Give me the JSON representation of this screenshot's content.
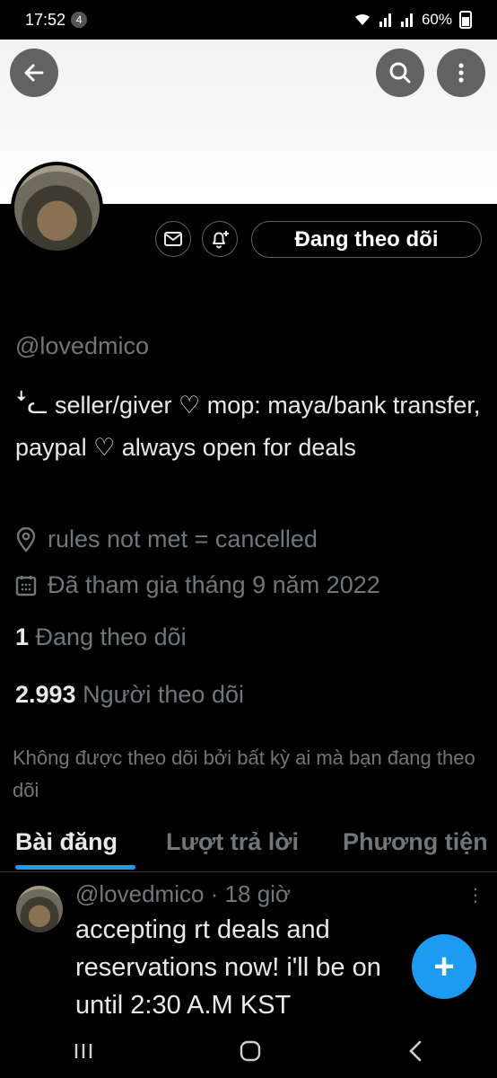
{
  "status": {
    "time": "17:52",
    "notif_count": "4",
    "battery": "60%"
  },
  "profile": {
    "handle": "@lovedmico",
    "bio": "ꜜᓚ seller/giver ♡ mop: maya/bank transfer, paypal ♡ always open for deals",
    "location": "rules not met = cancelled",
    "joined": "Đã tham gia tháng 9 năm 2022",
    "following_count": "1",
    "following_label": "Đang theo dõi",
    "followers_count": "2.993",
    "followers_label": "Người theo dõi",
    "not_followed_text": "Không được theo dõi bởi bất kỳ ai mà bạn đang theo dõi"
  },
  "actions": {
    "follow_button": "Đang theo dõi"
  },
  "tabs": [
    {
      "label": "Bài đăng"
    },
    {
      "label": "Lượt trả lời"
    },
    {
      "label": "Phương tiện"
    }
  ],
  "post": {
    "header": "@lovedmico · 18 giờ",
    "text": "accepting rt deals and reservations now! i'll be on until 2:30 A.M KST"
  },
  "fab": {
    "label": "+"
  },
  "colors": {
    "accent": "#1d9bf0",
    "background": "#000000",
    "secondary_text": "#71767b"
  }
}
